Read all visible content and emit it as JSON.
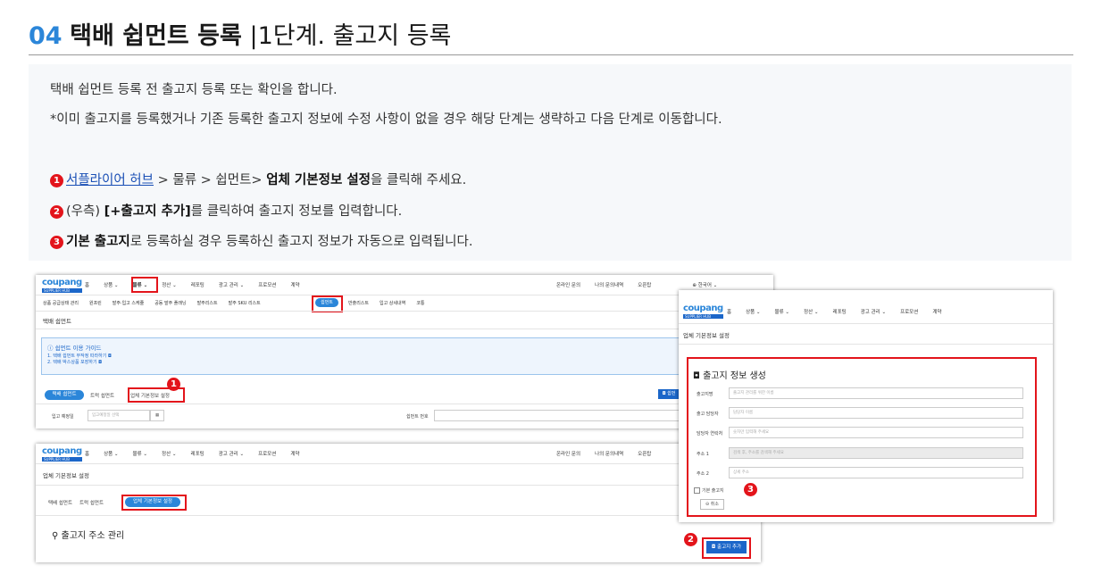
{
  "header": {
    "number": "04",
    "title_bold": "택배 쉽먼트 등록",
    "separator": "|",
    "subtitle": "1단계. 출고지 등록"
  },
  "intro": {
    "line1": "택배 쉽먼트 등록 전 출고지 등록 또는 확인을 합니다.",
    "line2": "*이미 출고지를 등록했거나 기존 등록한 출고지 정보에 수정 사항이 없을 경우 해당 단계는 생략하고 다음 단계로 이동합니다."
  },
  "steps": [
    {
      "num": "1",
      "link": "서플라이어 허브",
      "middle": " > 물류 > 쉽먼트> ",
      "bold": "업체 기본정보 설정",
      "rest": "을 클릭해 주세요."
    },
    {
      "num": "2",
      "pre": "(우측) ",
      "bold": "[+출고지 추가]",
      "rest": "를 클릭하여 출고지 정보를 입력합니다."
    },
    {
      "num": "3",
      "bold": "기본 출고지",
      "rest": "로 등록하실 경우 등록하신 출고지 정보가 자동으로 입력됩니다."
    }
  ],
  "screenshot1": {
    "logo": "coupang",
    "logo_sub": "SUPPLIER HUB",
    "nav": [
      "홈",
      "상품 ⌄",
      "물류 ⌄",
      "정산 ⌄",
      "레포팅",
      "광고 관리 ⌄",
      "프로모션",
      "계약"
    ],
    "nav_right": [
      "온라인 문의",
      "나의 문의내역",
      "오픈탑",
      "⊕ 한국어 ⌄"
    ],
    "subnav": [
      "상품 공급상태 관리",
      "원프린",
      "발주·입고 스케쥴",
      "공동 발주 플래닝",
      "발주리스트",
      "발주 SKU 리스트",
      "쉽먼트",
      "반출리스트",
      "입고 상세내역",
      "코통"
    ],
    "page_title": "택배 쉽먼트",
    "guide_title": "ⓘ 쉽먼트 이용 가이드",
    "guide_1": "1. 택배 쉽먼트 무작정 따라하기 ◘",
    "guide_2": "2. 택배 박스상품 포장하기 ◘",
    "tabs": [
      "택배 쉽먼트",
      "트럭 쉽먼트",
      "업체 기본정보 설정"
    ],
    "filter_label": "입고 예정일",
    "filter_placeholder": "입고예정일 선택",
    "cal_icon": "▦",
    "shipment_no": "쉽먼트 번호",
    "create_btn": "◘ 쉽먼"
  },
  "screenshot2": {
    "logo": "coupang",
    "logo_sub": "SUPPLIER HUB",
    "nav": [
      "홈",
      "상품 ⌄",
      "물류 ⌄",
      "정산 ⌄",
      "레포팅",
      "광고 관리 ⌄",
      "프로모션",
      "계약"
    ],
    "nav_right": [
      "온라인 문의",
      "나의 문의내역",
      "오픈탑"
    ],
    "page_title": "업체 기본정보 설정",
    "tabs": [
      "택배 쉽먼트",
      "트럭 쉽먼트",
      "업체 기본정보 설정"
    ],
    "section": "⚲ 출고지 주소 관리",
    "add_btn": "◘ 출고지 추가"
  },
  "screenshot3": {
    "logo": "coupang",
    "logo_sub": "SUPPLIER HUB",
    "nav": [
      "홈",
      "상품 ⌄",
      "물류 ⌄",
      "정산 ⌄",
      "레포팅",
      "광고 관리 ⌄",
      "프로모션",
      "계약"
    ],
    "page_title": "업체 기본정보 설정",
    "form_title": "◘ 출고지 정보 생성",
    "fields": [
      {
        "label": "출고지명",
        "placeholder": "출고지 관리를 위한 이름"
      },
      {
        "label": "출고 담당자",
        "placeholder": "담당자 이름"
      },
      {
        "label": "담당자 연락처",
        "placeholder": "숫자만 입력해 주세요"
      },
      {
        "label": "주소 1",
        "placeholder": "검색 후, 주소를 검색해 주세요"
      },
      {
        "label": "주소 2",
        "placeholder": "상세 주소"
      }
    ],
    "checkbox": "기본 출고지",
    "cancel": "⊖ 취소"
  },
  "colors": {
    "accent": "#2b86d9",
    "highlight": "#e3141b",
    "link": "#1a4fb5"
  }
}
